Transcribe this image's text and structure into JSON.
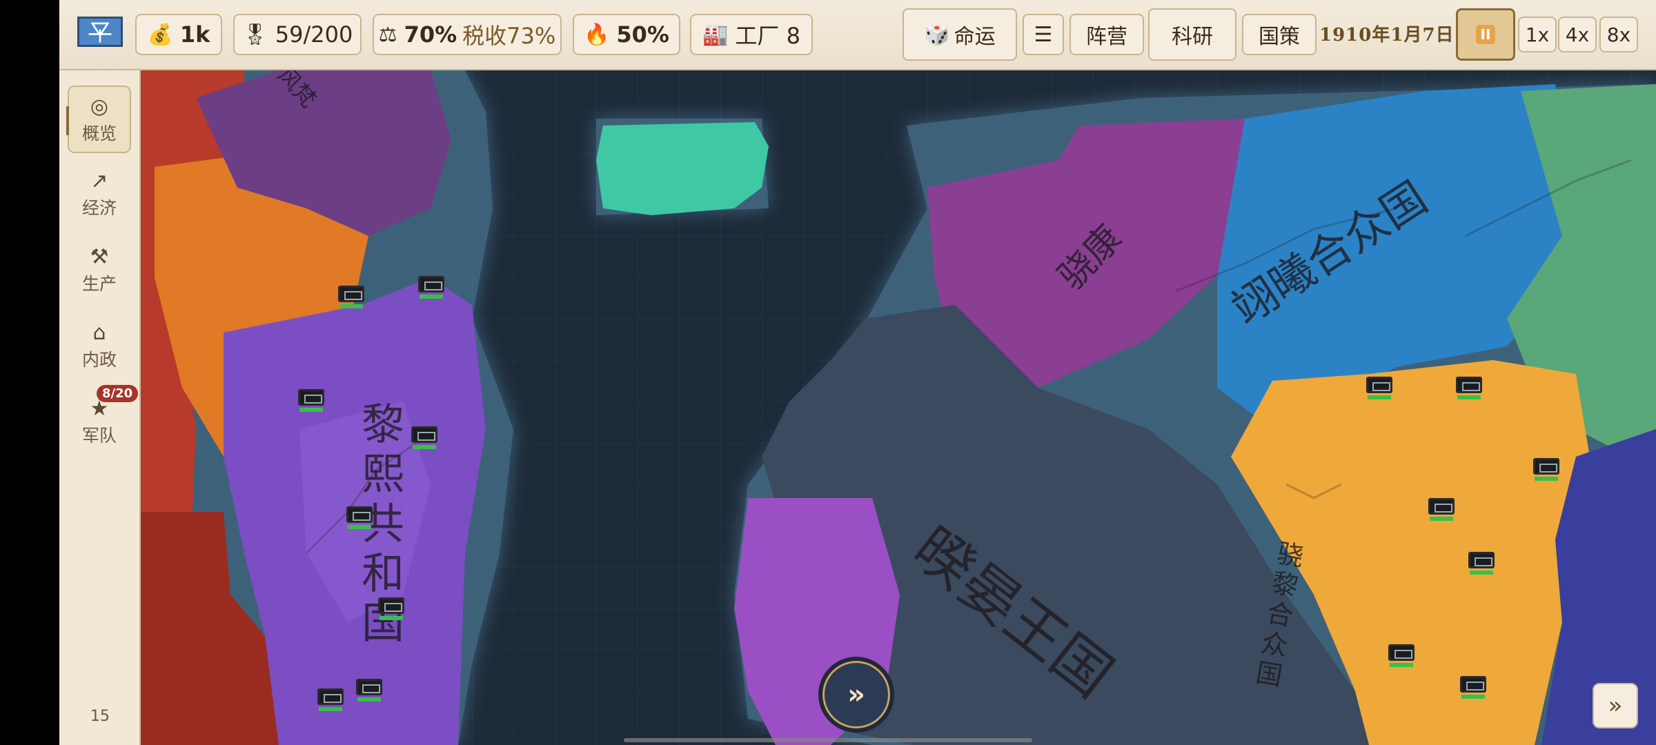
{
  "topbar": {
    "money": "1k",
    "prestige": "59/200",
    "stability": "70%",
    "tax": "税收73%",
    "war_support": "50%",
    "factory": "工厂 8",
    "fate": "命运",
    "menu": "☰",
    "faction": "阵营",
    "research": "科研",
    "policy": "国策",
    "date": "1910年1月7日",
    "speeds": [
      "1x",
      "4x",
      "8x"
    ]
  },
  "sidebar": {
    "items": [
      {
        "label": "概览",
        "icon": "overview-icon"
      },
      {
        "label": "经济",
        "icon": "economy-icon"
      },
      {
        "label": "生产",
        "icon": "production-icon"
      },
      {
        "label": "内政",
        "icon": "domestic-icon"
      },
      {
        "label": "军队",
        "icon": "army-icon",
        "badge": "8/20"
      }
    ],
    "page": "15"
  },
  "map": {
    "labels": [
      {
        "text": "风梵"
      },
      {
        "text": "黎熙共和国"
      },
      {
        "text": "骁康"
      },
      {
        "text": "翊曦合众国"
      },
      {
        "text": "暌晏王国"
      },
      {
        "text": "骁黎合众国"
      }
    ]
  },
  "buttons": {
    "center": "»",
    "corner": "»"
  },
  "colors": {
    "ocean": "#1d2a39",
    "purple": "#7b4ec4",
    "orange": "#e07a26",
    "red": "#b83a2a",
    "teal": "#3ec9a4",
    "magenta": "#8a3f92",
    "blue": "#2b83c6",
    "green": "#5aa77a",
    "slate": "#3b4a5e",
    "yellow": "#efa83a",
    "navy": "#3a3f9e"
  }
}
